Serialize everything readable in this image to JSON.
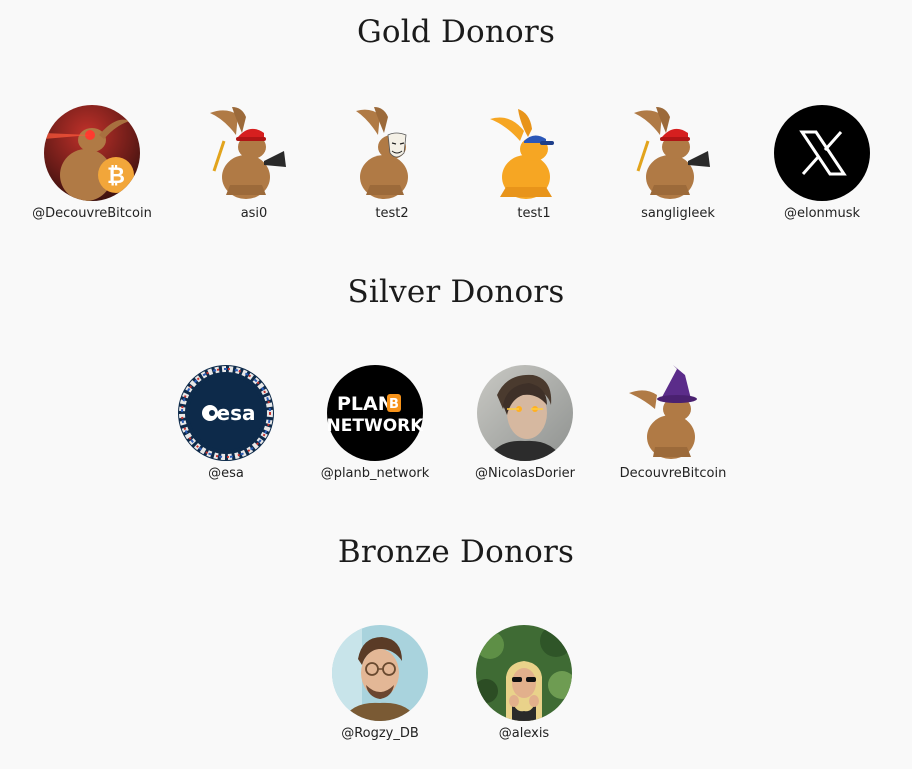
{
  "sections": [
    {
      "title": "Gold Donors",
      "donors": [
        {
          "name": "@DecouvreBitcoin",
          "avatar_icon": "bitcoin-rabbit-laser-eyes-avatar"
        },
        {
          "name": "asi0",
          "avatar_icon": "rabbit-miner-red-helmet-avatar"
        },
        {
          "name": "test2",
          "avatar_icon": "rabbit-guy-fawkes-mask-avatar"
        },
        {
          "name": "test1",
          "avatar_icon": "orange-rabbit-blue-cap-avatar"
        },
        {
          "name": "sangligleek",
          "avatar_icon": "rabbit-miner-red-helmet-avatar"
        },
        {
          "name": "@elonmusk",
          "avatar_icon": "x-logo-avatar"
        }
      ]
    },
    {
      "title": "Silver Donors",
      "donors": [
        {
          "name": "@esa",
          "avatar_icon": "esa-logo-avatar",
          "logo_text": "esa"
        },
        {
          "name": "@planb_network",
          "avatar_icon": "plan-b-network-logo-avatar",
          "logo_line1": "PLAN",
          "logo_badge": "B",
          "logo_line2": "NETWORK"
        },
        {
          "name": "@NicolasDorier",
          "avatar_icon": "man-laser-eyes-photo-avatar"
        },
        {
          "name": "DecouvreBitcoin",
          "avatar_icon": "rabbit-purple-wizard-hat-avatar"
        }
      ]
    },
    {
      "title": "Bronze Donors",
      "donors": [
        {
          "name": "@Rogzy_DB",
          "avatar_icon": "man-glasses-photo-avatar"
        },
        {
          "name": "@alexis",
          "avatar_icon": "woman-sunglasses-photo-avatar"
        }
      ]
    }
  ]
}
